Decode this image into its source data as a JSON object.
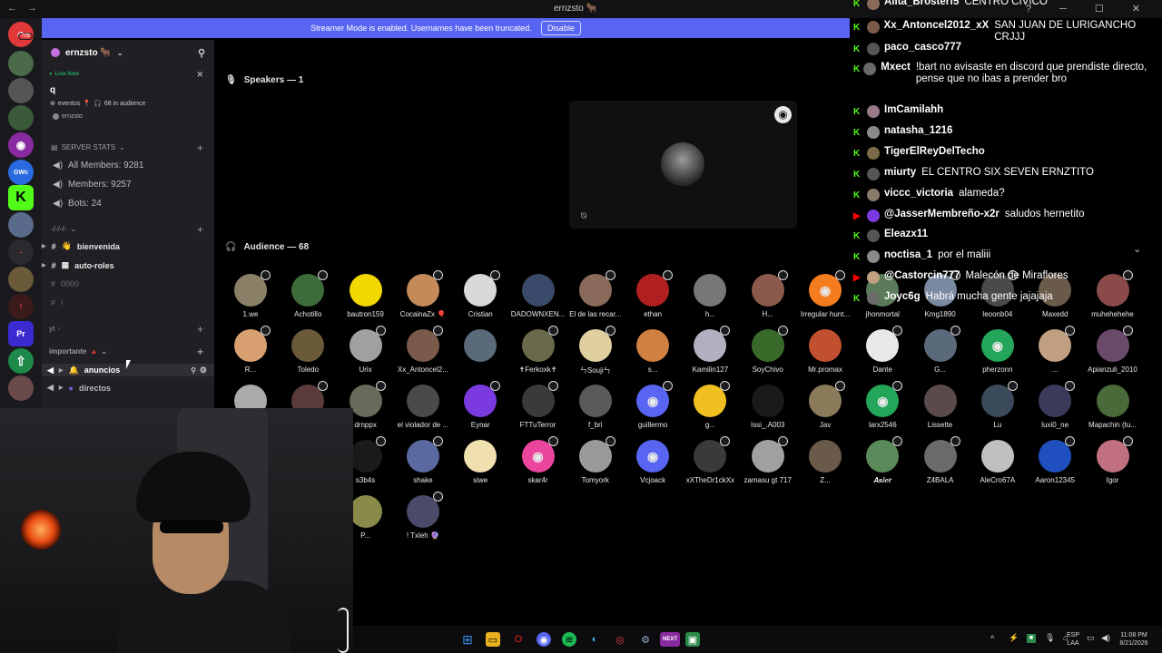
{
  "titlebar": {
    "title": "ernzsto 🐂"
  },
  "banner": {
    "text": "Streamer Mode is enabled. Usernames have been truncated.",
    "disable_label": "Disable"
  },
  "servers": {
    "badge": "709",
    "gwc_label": "GWc",
    "pr_label": "Pr"
  },
  "sidebar": {
    "server_name": "ernzsto 🐂",
    "live_now": "Live Now",
    "live_q": "q",
    "event_name": "eventos",
    "audience": "68 in audience",
    "event_host": "ernzsto",
    "cat_stats": "SERVER STATS",
    "stat_all": "All Members: 9281",
    "stat_members": "Members: 9257",
    "stat_bots": "Bots: 24",
    "cat_misc": "-/-/-/-",
    "ch_bienvenida": "bienvenida",
    "ch_autoroles": "auto-roles",
    "ch_0000": "0000",
    "ch_excl": "!",
    "cat_yt": "yt",
    "cat_importante": "importante",
    "ch_anuncios": "anuncios",
    "ch_directos": "directos"
  },
  "stage": {
    "speakers": "Speakers — 1",
    "audience": "Audience — 68"
  },
  "audience": [
    {
      "name": "1.we",
      "color": "#8a8068"
    },
    {
      "name": "Achotillo",
      "color": "#3e6b3a"
    },
    {
      "name": "bautron159",
      "color": "#f0d800"
    },
    {
      "name": "CocainaZx 🎈",
      "color": "#c48a5a"
    },
    {
      "name": "Cristian",
      "color": "#d8d8d8"
    },
    {
      "name": "DADOWNXEN...",
      "color": "#3a4a6a"
    },
    {
      "name": "El de las recar...",
      "color": "#8a6a5a"
    },
    {
      "name": "ethan",
      "color": "#b02020"
    },
    {
      "name": "h...",
      "color": "#777777"
    },
    {
      "name": "H...",
      "color": "#8a5a4a"
    },
    {
      "name": "Irregular hunt...",
      "color": "#f57c1f"
    },
    {
      "name": "jhonmortal",
      "color": "#5a7a5a"
    },
    {
      "name": "Kmg1890",
      "color": "#7a8aa0"
    },
    {
      "name": "leoonb04",
      "color": "#4a4a4a"
    },
    {
      "name": "Maxedd",
      "color": "#6a5a4a"
    },
    {
      "name": "muhehehehe",
      "color": "#8a4a4a"
    },
    {
      "name": "R...",
      "color": "#d8a070"
    },
    {
      "name": "Toledo",
      "color": "#6a5a3a"
    },
    {
      "name": "Urix",
      "color": "#a0a0a0"
    },
    {
      "name": "Xx_Antoncel2...",
      "color": "#7a5a4a"
    },
    {
      "name": "",
      "color": "#5a6a7a"
    },
    {
      "name": "✝Ferkoxk✝",
      "color": "#6a6a4a"
    },
    {
      "name": "ㄣSoujiㄣ",
      "color": "#e0d0a0"
    },
    {
      "name": "s...",
      "color": "#d08040"
    },
    {
      "name": "Kamilin127",
      "color": "#b0b0c0"
    },
    {
      "name": "SoyChivo",
      "color": "#3a6a2a"
    },
    {
      "name": "Mr.promax",
      "color": "#c05030"
    },
    {
      "name": "Dante",
      "color": "#e8e8e8"
    },
    {
      "name": "G...",
      "color": "#5a6a7a"
    },
    {
      "name": "pherzonn",
      "color": "#23a55a"
    },
    {
      "name": "...",
      "color": "#c0a080"
    },
    {
      "name": "Apianzuli_2010",
      "color": "#6a4a6a"
    },
    {
      "name": "",
      "color": "#aaaaaa"
    },
    {
      "name": "",
      "color": "#5a3a3a"
    },
    {
      "name": "drnppx",
      "color": "#6a6a5a"
    },
    {
      "name": "el violador de ...",
      "color": "#4a4a4a"
    },
    {
      "name": "Eynar",
      "color": "#7a3ae0"
    },
    {
      "name": "FTTuTerror",
      "color": "#3a3a3a"
    },
    {
      "name": "f_bri",
      "color": "#5a5a5a"
    },
    {
      "name": "guillermo",
      "color": "#5865f2"
    },
    {
      "name": "g...",
      "color": "#f0c020"
    },
    {
      "name": "Issi_.A003",
      "color": "#1a1a1a"
    },
    {
      "name": "Jav",
      "color": "#8a7a5a"
    },
    {
      "name": "larx2546",
      "color": "#23a55a"
    },
    {
      "name": "Lissette",
      "color": "#5a4a4a"
    },
    {
      "name": "Lu",
      "color": "#3a4a5a"
    },
    {
      "name": "luxi0_ne",
      "color": "#3a3a5a"
    },
    {
      "name": "Mapachin (tu...",
      "color": "#4a6a3a"
    },
    {
      "name": "s3b4s",
      "color": "#1a1a1a"
    },
    {
      "name": "shake",
      "color": "#5a6aa0"
    },
    {
      "name": "siwe",
      "color": "#f0e0b0"
    },
    {
      "name": "skar4r",
      "color": "#eb459e"
    },
    {
      "name": "Tomyork",
      "color": "#9a9a9a"
    },
    {
      "name": "Vcjoack",
      "color": "#5865f2"
    },
    {
      "name": "xXTheDr1ckXx",
      "color": "#3a3a3a"
    },
    {
      "name": "zamasu gt 717",
      "color": "#a0a0a0"
    },
    {
      "name": "Z...",
      "color": "#6a5a4a"
    },
    {
      "name": "𝑨𝒔𝒊𝒆𝒓",
      "color": "#5a8a5a"
    },
    {
      "name": "Z4BALA",
      "color": "#6a6a6a"
    },
    {
      "name": "AleCro67A",
      "color": "#c0c0c0"
    },
    {
      "name": "Aaron12345",
      "color": "#2050c0"
    },
    {
      "name": "Igor",
      "color": "#c07080"
    },
    {
      "name": "P...",
      "color": "#8a8a4a"
    },
    {
      "name": "! Txleh 🔮",
      "color": "#4a4a6a"
    }
  ],
  "chat": [
    {
      "platform": "kick",
      "user": "Alita_Brosterf5",
      "text": "CENTRO CIVICO",
      "color": "#8a6a5a"
    },
    {
      "platform": "kick",
      "user": "Xx_Antoncel2012_xX",
      "text": "SAN JUAN DE LURIGANCHO CRJJJ",
      "color": "#7a5a4a"
    },
    {
      "platform": "kick",
      "user": "paco_casco777",
      "text": "",
      "color": "#555555"
    },
    {
      "platform": "kick",
      "user": "Mxect",
      "text": "!bart no avisaste en discord que prendiste directo, pense que no ibas a prender bro",
      "color": "#6a6a6a"
    },
    {
      "platform": "kick",
      "user": "ImCamilahh",
      "text": "",
      "color": "#9a7a8a"
    },
    {
      "platform": "kick",
      "user": "natasha_1216",
      "text": "",
      "color": "#8a8a8a"
    },
    {
      "platform": "kick",
      "user": "TigerElReyDelTecho",
      "text": "",
      "color": "#7a6a4a"
    },
    {
      "platform": "kick",
      "user": "miurty",
      "text": "EL CENTRO SIX SEVEN ERNZTITO",
      "color": "#555555"
    },
    {
      "platform": "kick",
      "user": "viccc_victoria",
      "text": "alameda?",
      "color": "#8a7a6a"
    },
    {
      "platform": "yt",
      "user": "@JasserMembreño-x2r",
      "text": "saludos hernetito",
      "color": "#7a3ae0"
    },
    {
      "platform": "kick",
      "user": "Eleazx11",
      "text": "",
      "color": "#555555"
    },
    {
      "platform": "kick",
      "user": "noctisa_1",
      "text": "por el maliii",
      "color": "#8a8a8a"
    },
    {
      "platform": "yt",
      "user": "@Castorcin777",
      "text": "Malecón de Miraflores",
      "color": "#c0a080"
    },
    {
      "platform": "kick",
      "user": "Joyc6g",
      "text": "Habrá mucha gente jajajaja",
      "color": "#6a6a6a"
    }
  ],
  "taskbar": {
    "lang1": "ESP",
    "lang2": "LAA",
    "time": "11:08 PM",
    "date": "8/21/2026"
  }
}
